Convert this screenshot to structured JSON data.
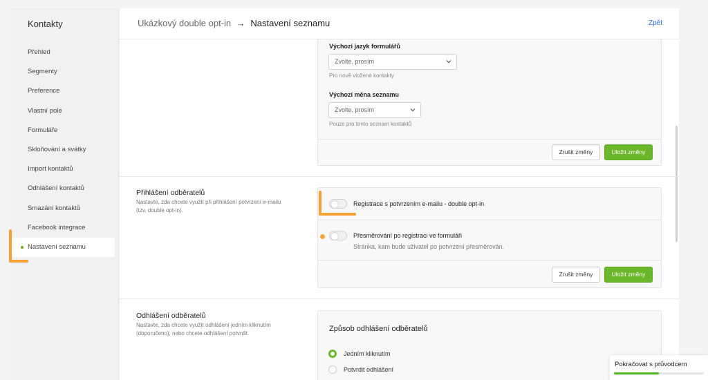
{
  "sidebar": {
    "title": "Kontakty",
    "items": [
      {
        "label": "Přehled"
      },
      {
        "label": "Segmenty"
      },
      {
        "label": "Preference"
      },
      {
        "label": "Vlastní pole"
      },
      {
        "label": "Formuláře"
      },
      {
        "label": "Skloňování a svátky"
      },
      {
        "label": "Import kontaktů"
      },
      {
        "label": "Odhlášení kontaktů"
      },
      {
        "label": "Smazání kontaktů"
      },
      {
        "label": "Facebook integrace"
      },
      {
        "label": "Nastavení seznamu",
        "active": true
      }
    ]
  },
  "header": {
    "breadcrumb_parent": "Ukázkový double opt-in",
    "breadcrumb_arrow": "→",
    "breadcrumb_current": "Nastavení seznamu",
    "back_label": "Zpět"
  },
  "language_card": {
    "form_language_label": "Výchozí jazyk formulářů",
    "form_language_value": "Zvolte, prosím",
    "form_language_hint": "Pro nově vložené kontakty",
    "currency_label": "Výchozí měna seznamu",
    "currency_value": "Zvolte, prosím",
    "currency_hint": "Pouze pro tento seznam kontaktů",
    "cancel_label": "Zrušit změny",
    "save_label": "Uložit změny"
  },
  "subscription_section": {
    "title": "Přihlášení odběratelů",
    "description": "Nastavte, zda chcete využít při přihlášení potvrzení e-mailu (tzv. double opt-in).",
    "double_optin_label": "Registrace s potvrzením e-mailu - double opt-in",
    "double_optin_enabled": false,
    "redirect_label": "Přesměrování po registraci ve formuláři",
    "redirect_hint": "Stránka, kam bude uživatel po potvrzení přesměrován.",
    "redirect_enabled": false,
    "cancel_label": "Zrušit změny",
    "save_label": "Uložit změny"
  },
  "unsubscribe_section": {
    "title": "Odhlášení odběratelů",
    "description": "Nastavte, zda chcete využít odhlášení jedním kliknutím (doporučeno), nebo chcete odhlášení potvrdit.",
    "card_title": "Způsob odhlášení odběratelů",
    "options": [
      {
        "label": "Jedním kliknutím",
        "selected": true
      },
      {
        "label": "Potvrdit odhlášení",
        "selected": false
      }
    ]
  },
  "guide": {
    "label": "Pokračovat s průvodcem",
    "progress": 0.5
  },
  "colors": {
    "accent_green": "#6ab82a",
    "annotation_orange": "#f4a236",
    "link_blue": "#2b6fd6"
  }
}
